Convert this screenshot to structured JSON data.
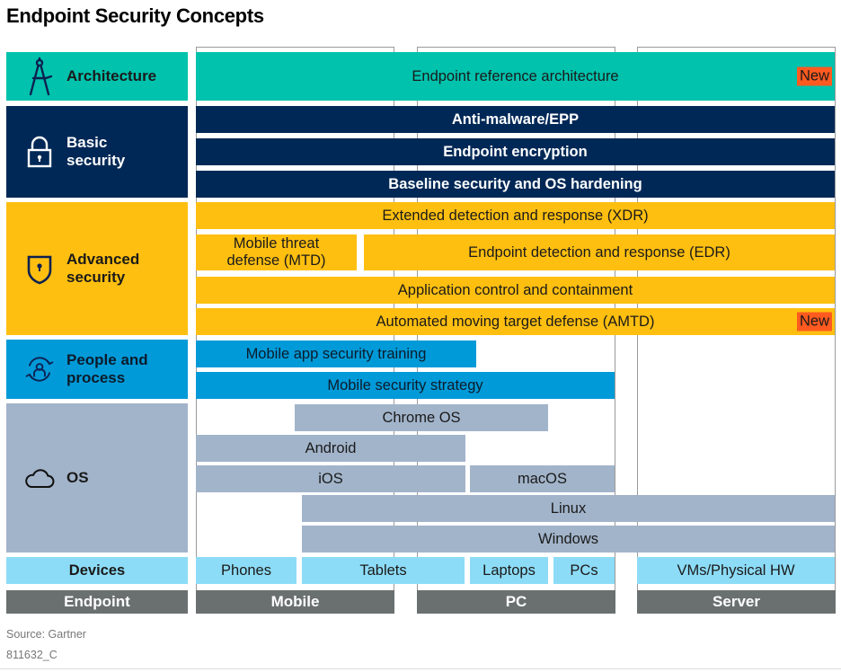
{
  "title": "Endpoint Security Concepts",
  "colors": {
    "architecture": "#00c2ad",
    "basic_security": "#002856",
    "advanced_security": "#ffbf10",
    "people_process": "#009ad8",
    "os": "#a2b4ca",
    "devices": "#8ddcf7",
    "endpoint_footer": "#6a7070",
    "new_tag": "#ff5a1f"
  },
  "categories": {
    "architecture": {
      "label": "Architecture",
      "icon": "compass-icon"
    },
    "basic_security": {
      "label": "Basic security",
      "icon": "padlock-icon"
    },
    "advanced_security": {
      "label": "Advanced security",
      "icon": "shield-icon"
    },
    "people_process": {
      "label": "People and process",
      "icon": "person-cycle-icon"
    },
    "os": {
      "label": "OS",
      "icon": "cloud-icon"
    },
    "devices": {
      "label": "Devices"
    }
  },
  "bars": {
    "architecture": {
      "label": "Endpoint reference architecture",
      "new": "New"
    },
    "anti_malware": {
      "label": "Anti-malware/EPP"
    },
    "encryption": {
      "label": "Endpoint encryption"
    },
    "baseline": {
      "label": "Baseline security and OS hardening"
    },
    "xdr": {
      "label": "Extended detection and response (XDR)"
    },
    "mtd": {
      "label": "Mobile threat defense (MTD)"
    },
    "edr": {
      "label": "Endpoint detection and response (EDR)"
    },
    "app_control": {
      "label": "Application control and containment"
    },
    "amtd": {
      "label": "Automated moving target defense (AMTD)",
      "new": "New"
    },
    "mobile_training": {
      "label": "Mobile app security training"
    },
    "mobile_strategy": {
      "label": "Mobile security strategy"
    },
    "chrome_os": {
      "label": "Chrome OS"
    },
    "android": {
      "label": "Android"
    },
    "ios": {
      "label": "iOS"
    },
    "macos": {
      "label": "macOS"
    },
    "linux": {
      "label": "Linux"
    },
    "windows": {
      "label": "Windows"
    }
  },
  "devices": {
    "phones": "Phones",
    "tablets": "Tablets",
    "laptops": "Laptops",
    "pcs": "PCs",
    "servers": "VMs/Physical HW"
  },
  "footer": {
    "endpoint": "Endpoint",
    "mobile": "Mobile",
    "pc": "PC",
    "server": "Server"
  },
  "source": "Source: Gartner",
  "doc_id": "811632_C"
}
